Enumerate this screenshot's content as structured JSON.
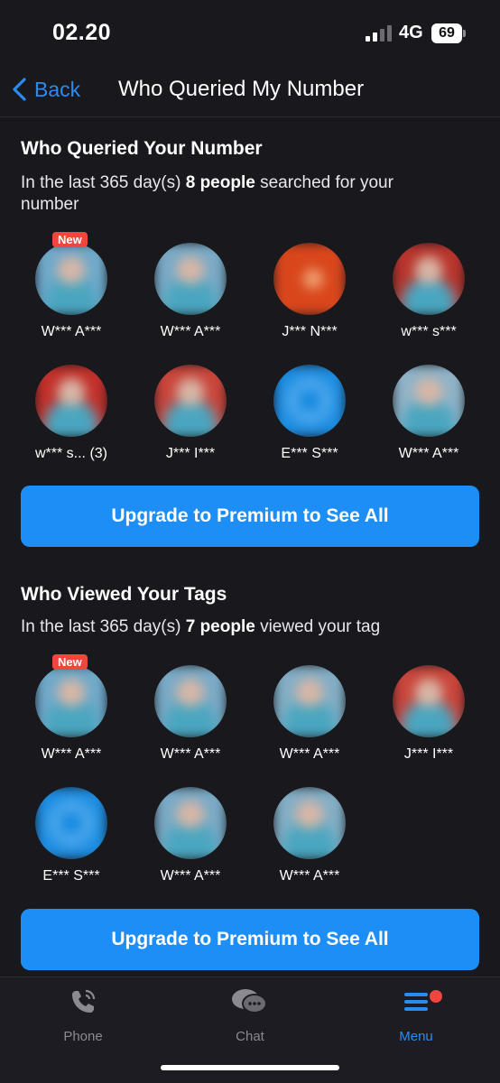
{
  "status_bar": {
    "time": "02.20",
    "network": "4G",
    "battery": "69"
  },
  "nav": {
    "back_label": "Back",
    "title": "Who Queried My Number"
  },
  "queried": {
    "title": "Who Queried Your Number",
    "desc_prefix": "In the last 365 day(s) ",
    "count_bold": "8 people",
    "desc_suffix": " searched for your number",
    "people": [
      {
        "name": "W*** A***",
        "new": "New",
        "avatar_color": "#6fa9c9"
      },
      {
        "name": "W*** A***",
        "avatar_color": "#7aaac6"
      },
      {
        "name": "J*** N***",
        "avatar_color": "#d9461c"
      },
      {
        "name": "w*** s***",
        "avatar_color": "#b8342c"
      },
      {
        "name": "w*** s... (3)",
        "avatar_color": "#c2302a"
      },
      {
        "name": "J*** I***",
        "avatar_color": "#c9453b"
      },
      {
        "name": "E*** S***",
        "avatar_color": "#1a8be0"
      },
      {
        "name": "W*** A***",
        "avatar_color": "#8fb3c8"
      }
    ],
    "upgrade_label": "Upgrade to Premium to See All"
  },
  "viewed": {
    "title": "Who Viewed Your Tags",
    "desc_prefix": "In the last 365 day(s) ",
    "count_bold": "7 people",
    "desc_suffix": " viewed your tag",
    "people": [
      {
        "name": "W*** A***",
        "new": "New",
        "avatar_color": "#6fa9c9"
      },
      {
        "name": "W*** A***",
        "avatar_color": "#7aaac6"
      },
      {
        "name": "W*** A***",
        "avatar_color": "#82aec5"
      },
      {
        "name": "J*** I***",
        "avatar_color": "#c9453b"
      },
      {
        "name": "E*** S***",
        "avatar_color": "#1a8be0"
      },
      {
        "name": "W*** A***",
        "avatar_color": "#7aaac6"
      },
      {
        "name": "W*** A***",
        "avatar_color": "#82aec5"
      }
    ],
    "upgrade_label": "Upgrade to Premium to See All"
  },
  "tabs": [
    {
      "label": "Phone",
      "icon": "phone-icon"
    },
    {
      "label": "Chat",
      "icon": "chat-icon"
    },
    {
      "label": "Menu",
      "icon": "menu-icon",
      "active": true
    }
  ],
  "colors": {
    "accent": "#1e8ef7",
    "background": "#18181d",
    "badge": "#f0463d"
  }
}
